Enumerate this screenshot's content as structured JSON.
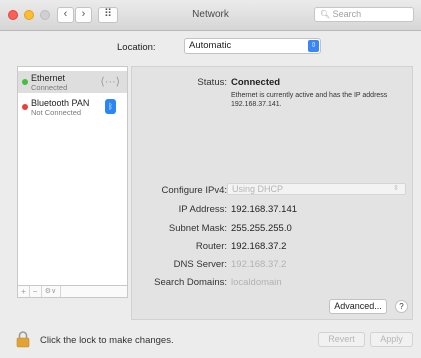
{
  "window": {
    "title": "Network",
    "search_placeholder": "Search",
    "back_glyph": "‹",
    "forward_glyph": "›",
    "grid_glyph": "⠿"
  },
  "location": {
    "label": "Location:",
    "value": "Automatic",
    "arrow_glyph": "⇳"
  },
  "sidebar": {
    "services": [
      {
        "name": "Ethernet",
        "status": "Connected",
        "dot_color": "#3ec13c",
        "icon": "ethernet-icon",
        "icon_glyph": "⟨···⟩"
      },
      {
        "name": "Bluetooth PAN",
        "status": "Not Connected",
        "dot_color": "#ea3f3a",
        "icon": "bluetooth-icon",
        "icon_glyph": "ᛒ"
      }
    ],
    "tools": {
      "add": "+",
      "remove": "−",
      "action": "⚙∨"
    }
  },
  "detail": {
    "status_label": "Status:",
    "status_value": "Connected",
    "status_description": "Ethernet is currently active and has the IP address 192.168.37.141.",
    "configure_label": "Configure IPv4:",
    "configure_value": "Using DHCP",
    "configure_arrow": "⇳",
    "ip_label": "IP Address:",
    "ip_value": "192.168.37.141",
    "mask_label": "Subnet Mask:",
    "mask_value": "255.255.255.0",
    "router_label": "Router:",
    "router_value": "192.168.37.2",
    "dns_label": "DNS Server:",
    "dns_value": "192.168.37.2",
    "domains_label": "Search Domains:",
    "domains_value": "localdomain",
    "advanced_button": "Advanced...",
    "help_button": "?"
  },
  "footer": {
    "lock_text": "Click the lock to make changes.",
    "revert_button": "Revert",
    "apply_button": "Apply"
  },
  "colors": {
    "accent": "#3b86f7",
    "lock": "#e2a335"
  }
}
